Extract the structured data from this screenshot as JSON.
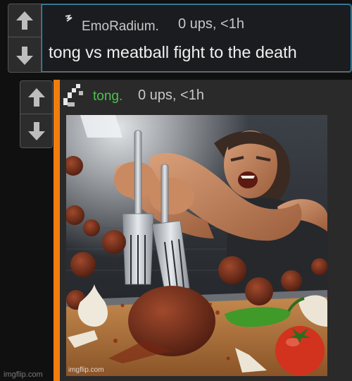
{
  "comment": {
    "username": "EmoRadium.",
    "meta": "0 ups, <1h",
    "text": "tong vs meatball fight to the death"
  },
  "reply": {
    "username": "tong.",
    "meta": "0 ups, <1h",
    "image_alt": "muscular man stabbing a meatball with two forks",
    "image_watermark": "imgflip.com"
  },
  "site_watermark": "imgflip.com",
  "icons": {
    "upvote": "arrow-up-icon",
    "downvote": "arrow-down-icon"
  },
  "colors": {
    "accent_blue": "#2d8fb8",
    "reply_bar": "#f07d0e",
    "username_green": "#4fc24f"
  }
}
